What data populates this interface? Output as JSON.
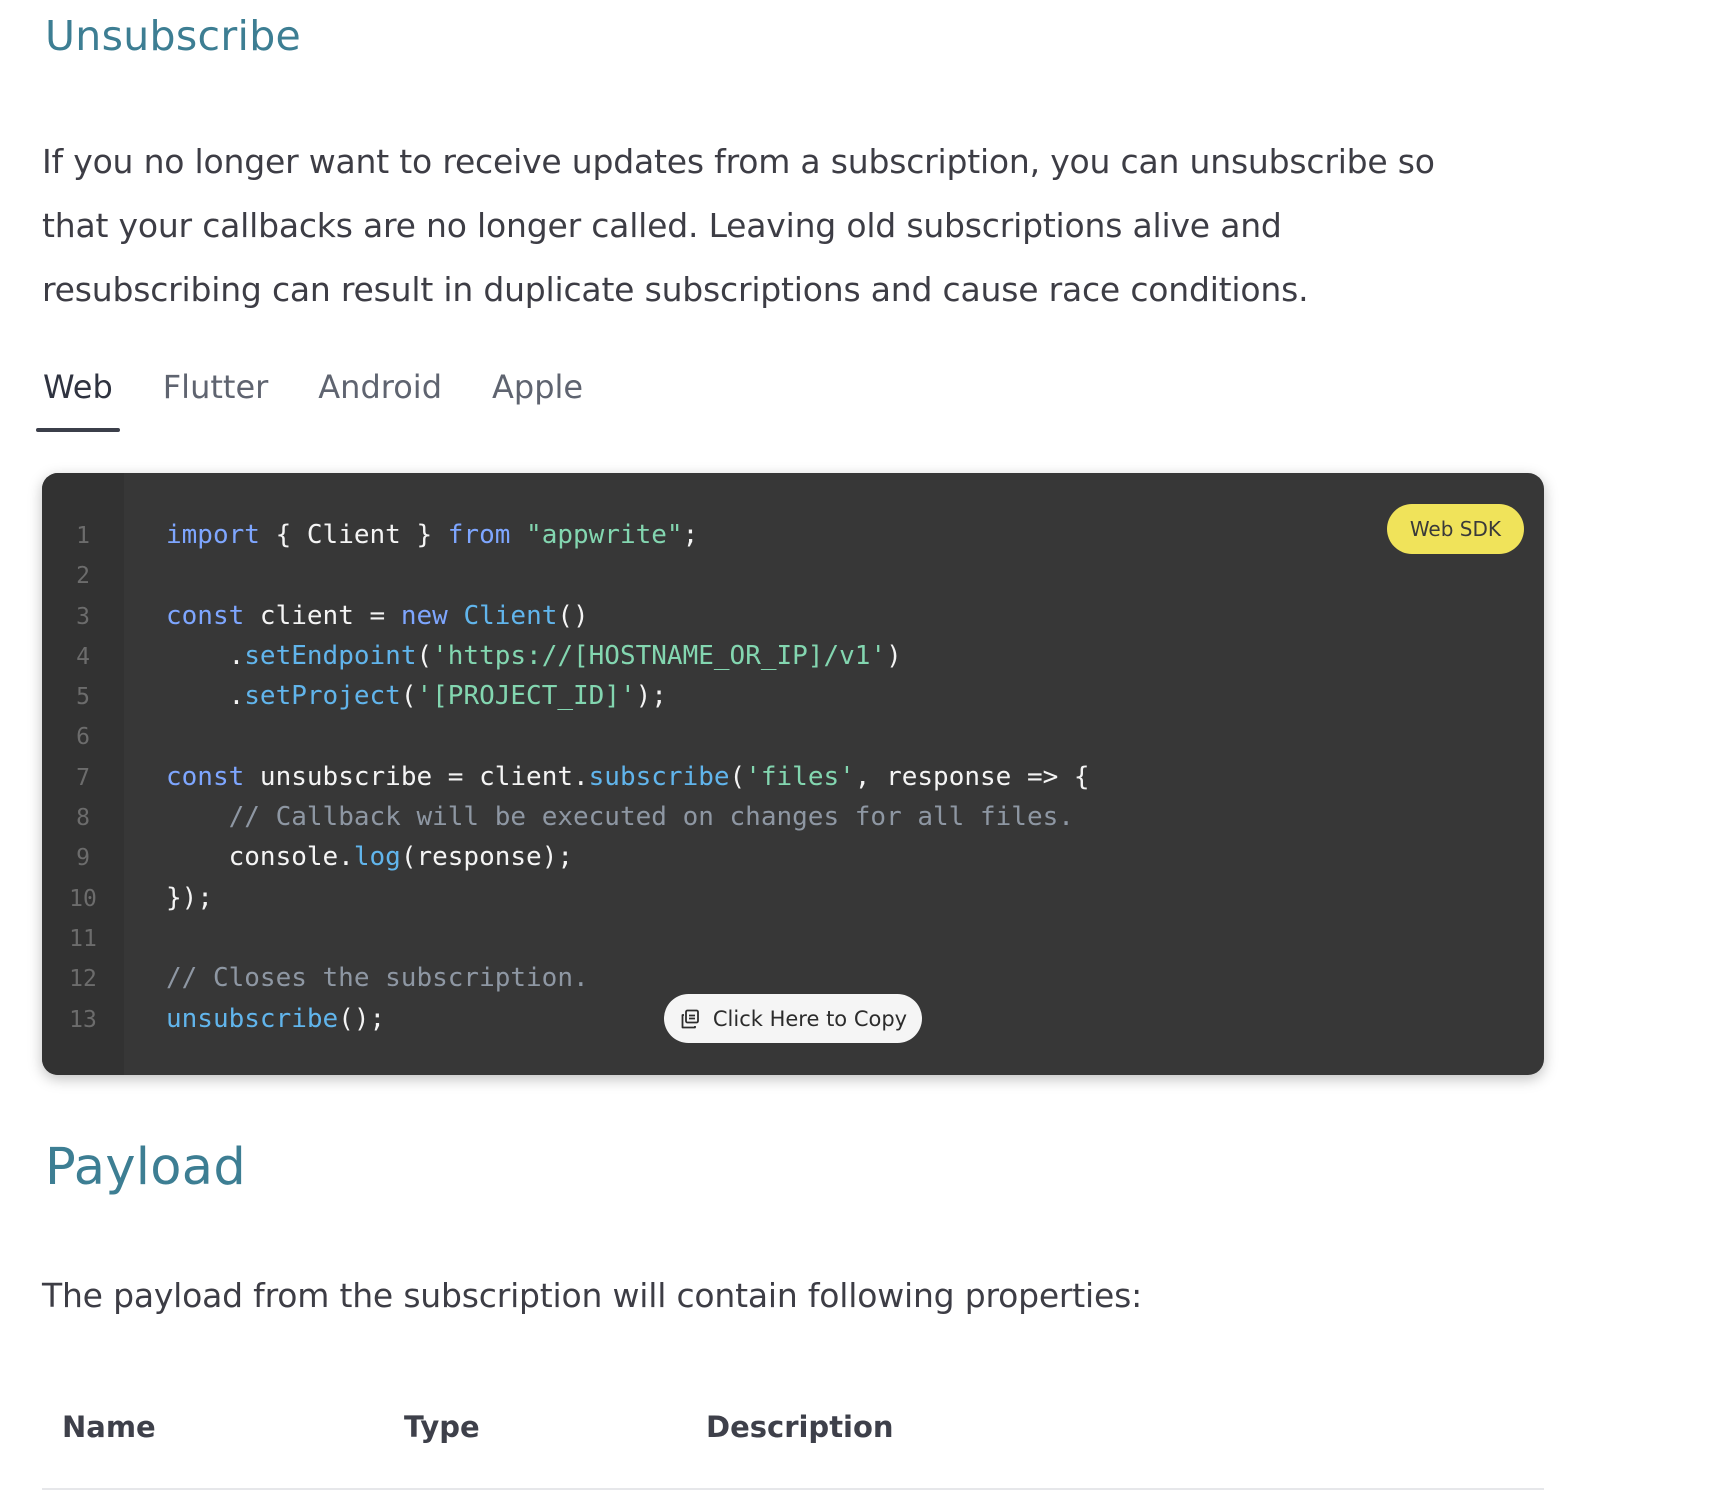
{
  "sections": {
    "unsubscribe_title": "Unsubscribe",
    "unsubscribe_text": "If you no longer want to receive updates from a subscription, you can unsubscribe so that your callbacks are no longer called. Leaving old subscriptions alive and resubscribing can result in duplicate subscriptions and cause race conditions.",
    "payload_title": "Payload",
    "payload_text": "The payload from the subscription will contain following properties:"
  },
  "tabs": [
    {
      "label": "Web",
      "active": true
    },
    {
      "label": "Flutter",
      "active": false
    },
    {
      "label": "Android",
      "active": false
    },
    {
      "label": "Apple",
      "active": false
    }
  ],
  "code": {
    "badge": "Web SDK",
    "copy_label": "Click Here to Copy",
    "copy_icon": "copy-icon",
    "lines": [
      {
        "n": "1",
        "tokens": [
          [
            "kw",
            "import"
          ],
          [
            "p",
            " { Client } "
          ],
          [
            "kw",
            "from"
          ],
          [
            "p",
            " "
          ],
          [
            "str",
            "\"appwrite\""
          ],
          [
            "p",
            ";"
          ]
        ]
      },
      {
        "n": "2",
        "tokens": []
      },
      {
        "n": "3",
        "tokens": [
          [
            "kw",
            "const"
          ],
          [
            "p",
            " client = "
          ],
          [
            "kw",
            "new"
          ],
          [
            "p",
            " "
          ],
          [
            "fn",
            "Client"
          ],
          [
            "p",
            "()"
          ]
        ]
      },
      {
        "n": "4",
        "tokens": [
          [
            "p",
            "    ."
          ],
          [
            "fn",
            "setEndpoint"
          ],
          [
            "p",
            "("
          ],
          [
            "str",
            "'https://[HOSTNAME_OR_IP]/v1'"
          ],
          [
            "p",
            ")"
          ]
        ]
      },
      {
        "n": "5",
        "tokens": [
          [
            "p",
            "    ."
          ],
          [
            "fn",
            "setProject"
          ],
          [
            "p",
            "("
          ],
          [
            "str",
            "'[PROJECT_ID]'"
          ],
          [
            "p",
            ");"
          ]
        ]
      },
      {
        "n": "6",
        "tokens": []
      },
      {
        "n": "7",
        "tokens": [
          [
            "kw",
            "const"
          ],
          [
            "p",
            " unsubscribe = client."
          ],
          [
            "fn",
            "subscribe"
          ],
          [
            "p",
            "("
          ],
          [
            "str",
            "'files'"
          ],
          [
            "p",
            ", response => {"
          ]
        ]
      },
      {
        "n": "8",
        "tokens": [
          [
            "p",
            "    "
          ],
          [
            "cm",
            "// Callback will be executed on changes for all files."
          ]
        ]
      },
      {
        "n": "9",
        "tokens": [
          [
            "p",
            "    console."
          ],
          [
            "fn",
            "log"
          ],
          [
            "p",
            "(response);"
          ]
        ]
      },
      {
        "n": "10",
        "tokens": [
          [
            "p",
            "});"
          ]
        ]
      },
      {
        "n": "11",
        "tokens": []
      },
      {
        "n": "12",
        "tokens": [
          [
            "cm",
            "// Closes the subscription."
          ]
        ]
      },
      {
        "n": "13",
        "tokens": [
          [
            "fn",
            "unsubscribe"
          ],
          [
            "p",
            "();"
          ]
        ]
      }
    ]
  },
  "table": {
    "headers": {
      "name": "Name",
      "type": "Type",
      "description": "Description"
    }
  }
}
